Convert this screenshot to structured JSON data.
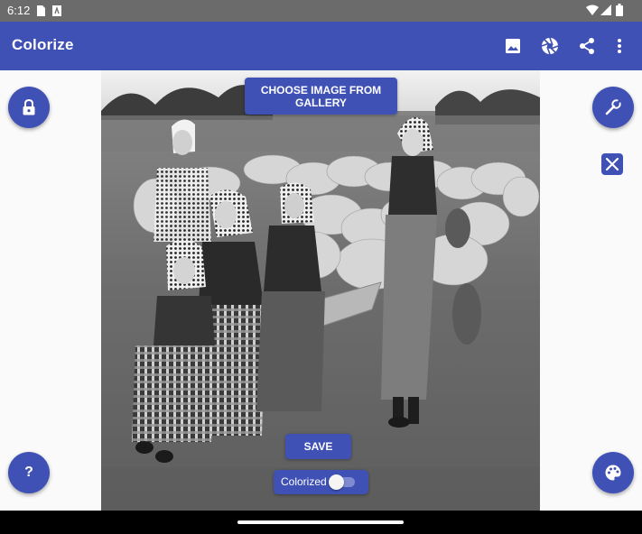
{
  "status_bar": {
    "time": "6:12"
  },
  "app_bar": {
    "title": "Colorize",
    "actions": [
      "image-icon",
      "aperture-icon",
      "share-icon",
      "more-vert-icon"
    ]
  },
  "photo": {
    "choose_button": "CHOOSE IMAGE FROM GALLERY",
    "save_button": "SAVE",
    "toggle": {
      "label": "Colorized",
      "state": "off"
    }
  },
  "left_fabs": [
    "lock-icon",
    "help-icon"
  ],
  "help_label": "?",
  "right_fabs": [
    "wrench-icon",
    "palette-icon"
  ],
  "colors": {
    "primary": "#3f51b5",
    "status_bar": "#6b6b6b"
  }
}
